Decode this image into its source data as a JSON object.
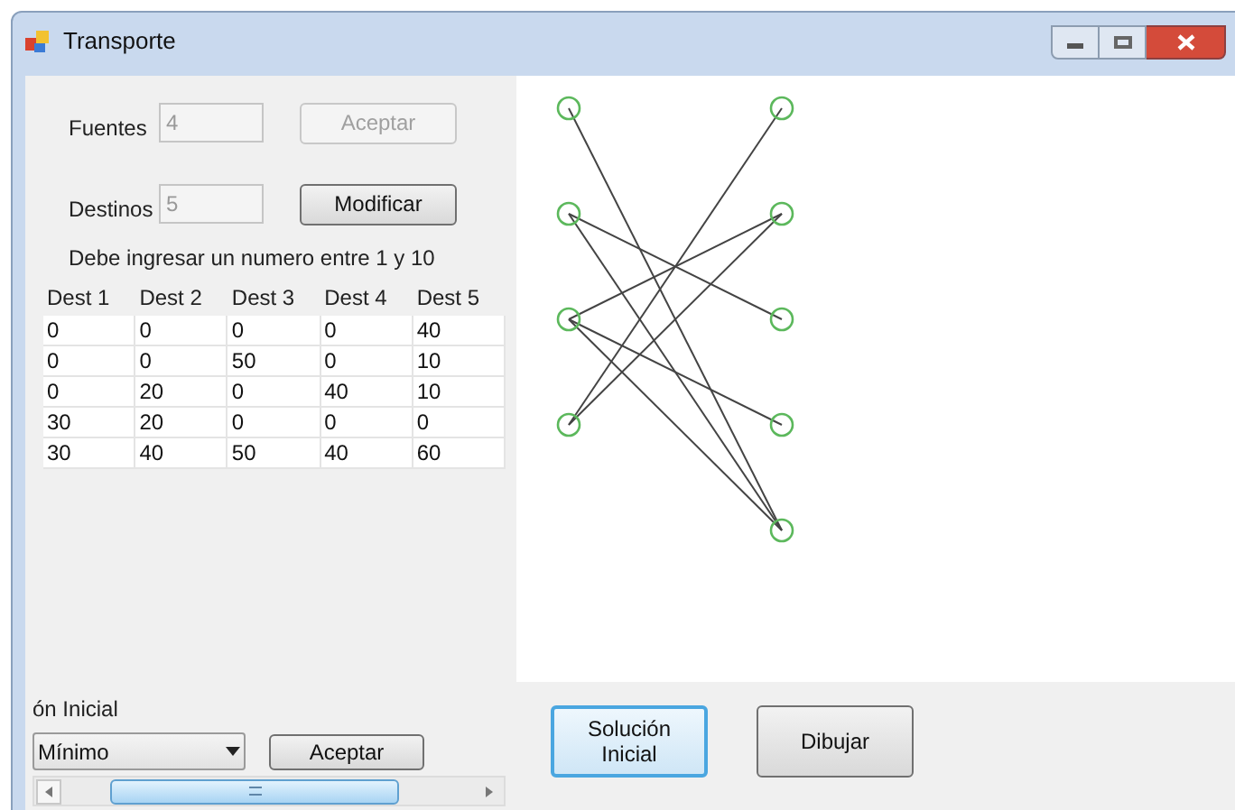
{
  "window": {
    "title": "Transporte"
  },
  "fuentes": {
    "label": "Fuentes",
    "value": "4",
    "button": "Aceptar",
    "button_disabled": true
  },
  "destinos": {
    "label": "Destinos",
    "value": "5",
    "button": "Modificar",
    "button_disabled": false
  },
  "hint": "Debe ingresar un numero entre 1 y 10",
  "table": {
    "columns": [
      "Dest 1",
      "Dest 2",
      "Dest 3",
      "Dest 4",
      "Dest 5"
    ],
    "rows": [
      [
        "0",
        "0",
        "0",
        "0",
        "40"
      ],
      [
        "0",
        "0",
        "50",
        "0",
        "10"
      ],
      [
        "0",
        "20",
        "0",
        "40",
        "10"
      ],
      [
        "30",
        "20",
        "0",
        "0",
        "0"
      ],
      [
        "30",
        "40",
        "50",
        "40",
        "60"
      ]
    ]
  },
  "method": {
    "label": "ón Inicial",
    "value": "Mínimo",
    "button": "Aceptar"
  },
  "actions": [
    {
      "label": "Solución Inicial",
      "focused": true
    },
    {
      "label": "Dibujar",
      "focused": false
    }
  ]
}
